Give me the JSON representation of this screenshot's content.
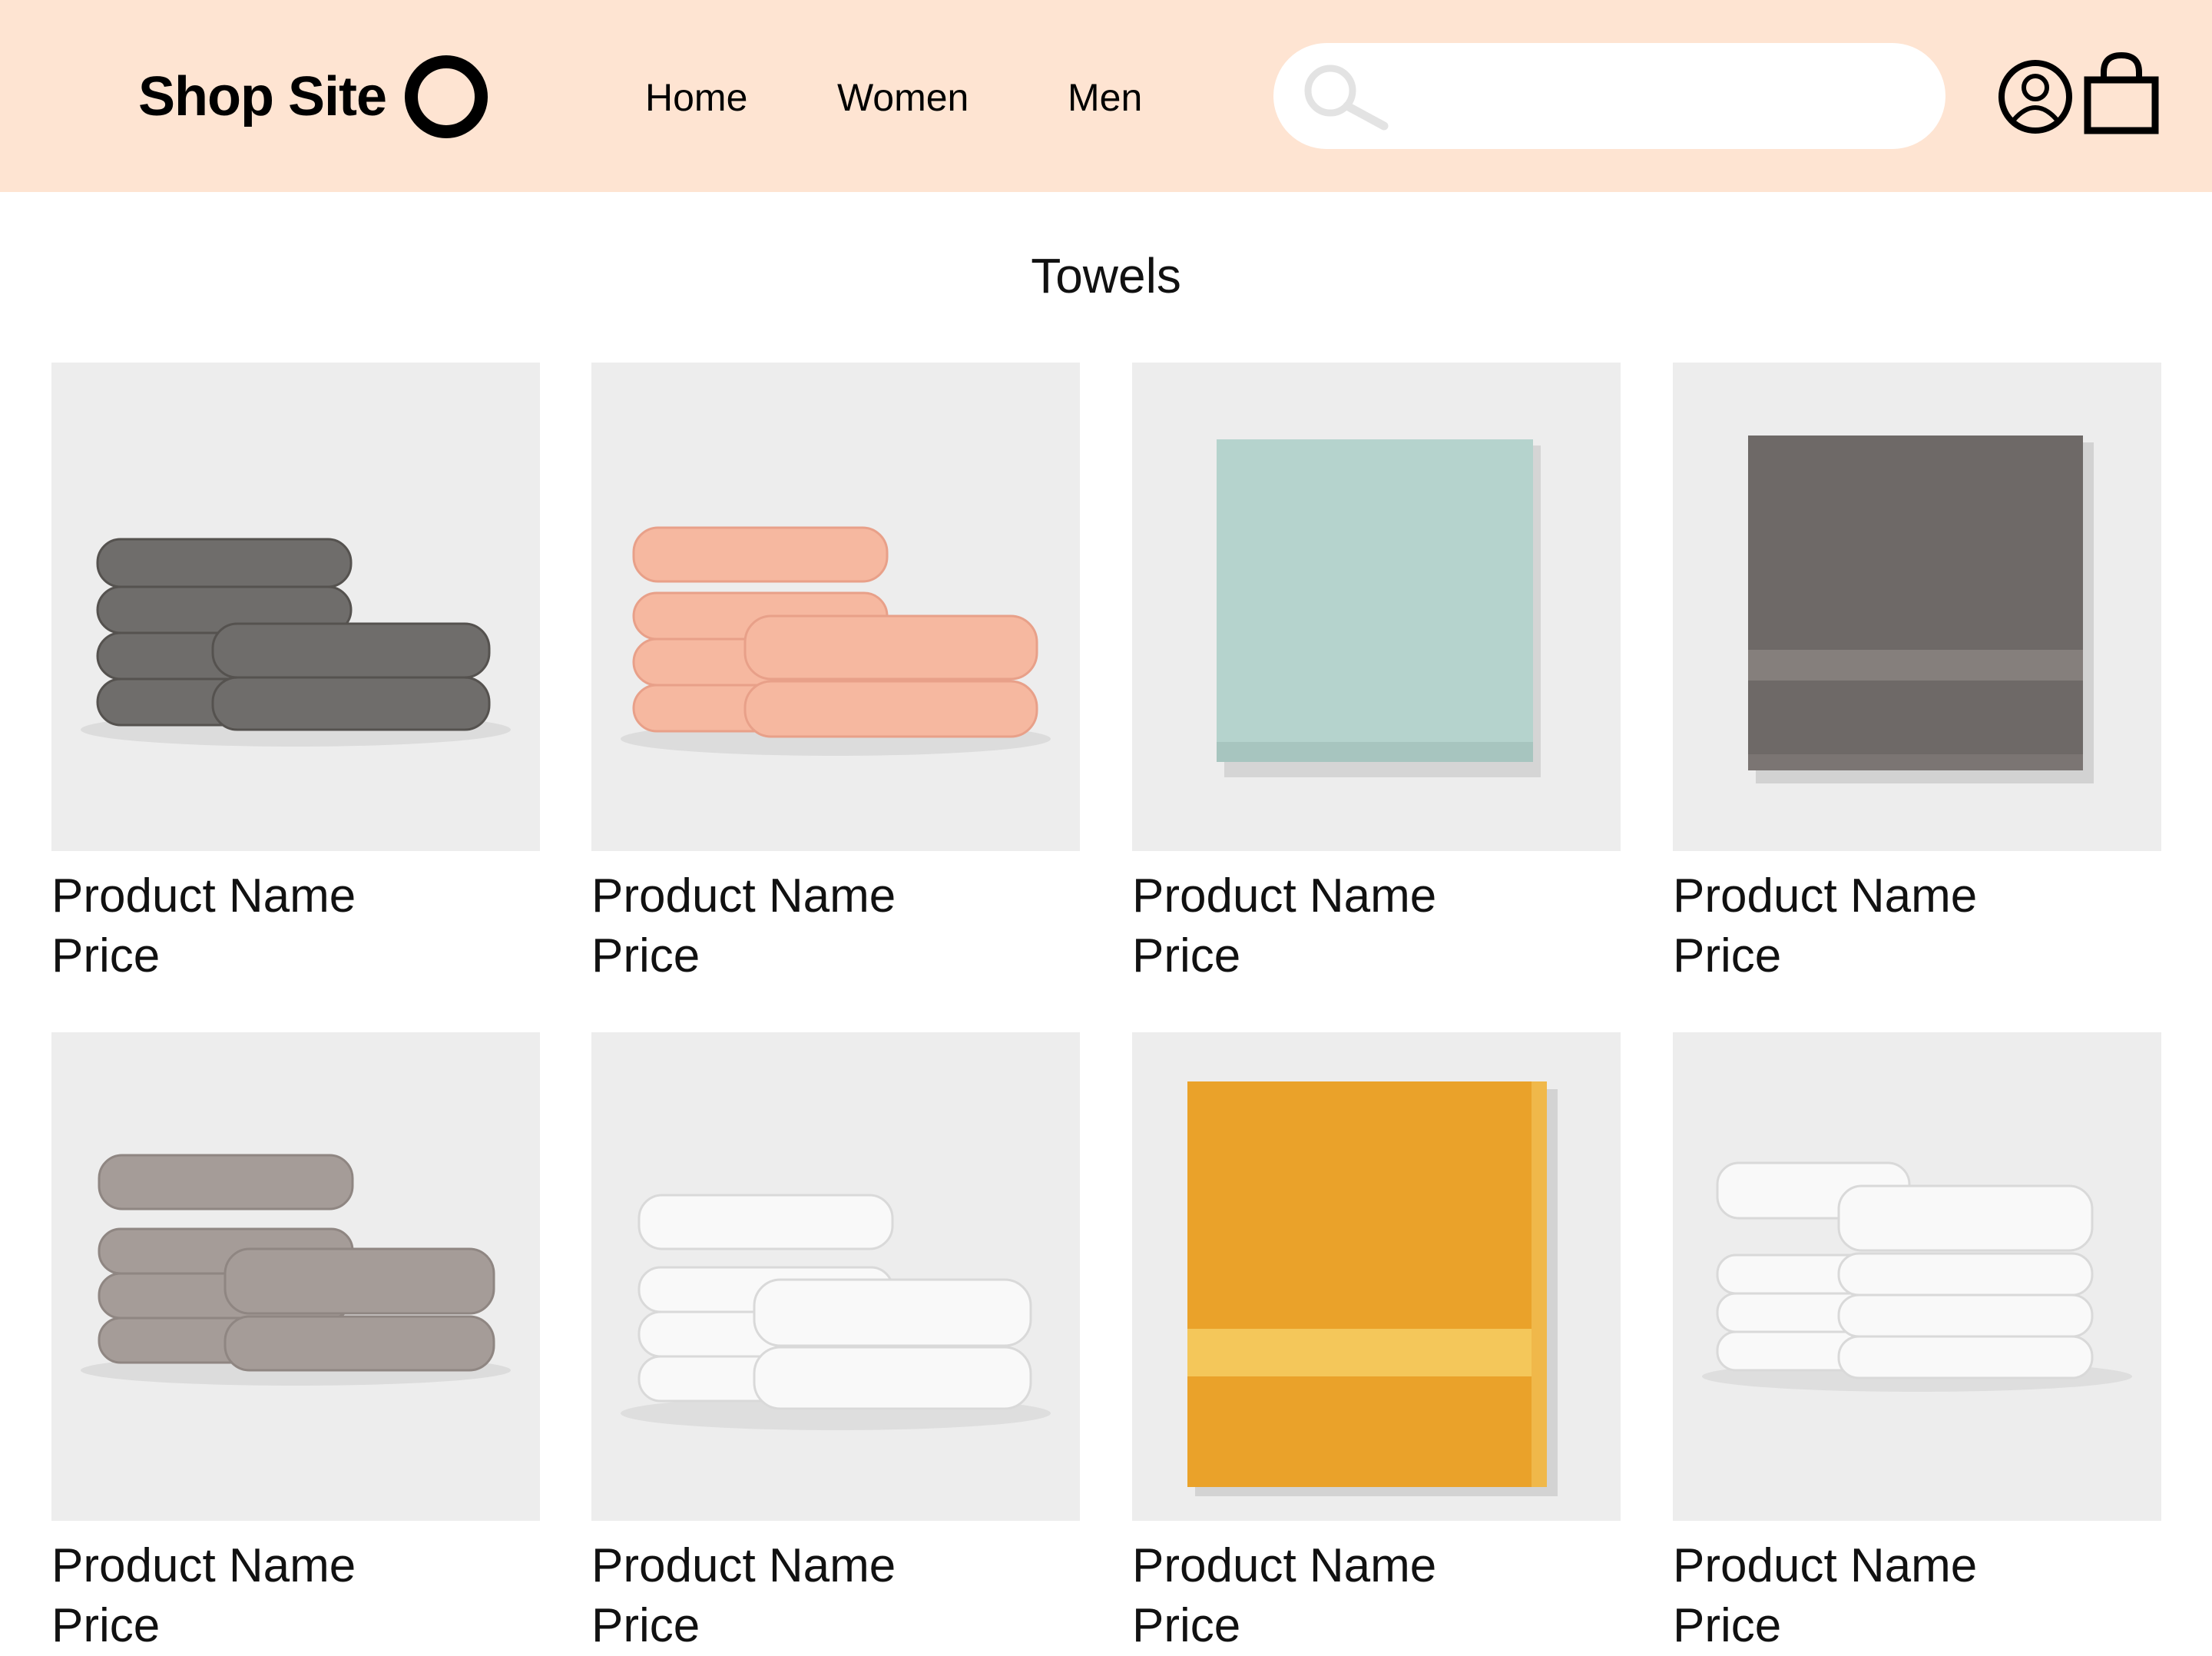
{
  "header": {
    "logo_text": "Shop Site",
    "nav": [
      {
        "label": "Home"
      },
      {
        "label": "Women"
      },
      {
        "label": "Men"
      }
    ],
    "search": {
      "placeholder": "",
      "value": ""
    }
  },
  "page": {
    "title": "Towels"
  },
  "products": [
    {
      "name": "Product Name",
      "price": "Price",
      "image": "stack-gray-towels"
    },
    {
      "name": "Product Name",
      "price": "Price",
      "image": "stack-peach-towels"
    },
    {
      "name": "Product Name",
      "price": "Price",
      "image": "folded-mint-towel"
    },
    {
      "name": "Product Name",
      "price": "Price",
      "image": "folded-charcoal-towel"
    },
    {
      "name": "Product Name",
      "price": "Price",
      "image": "stack-taupe-towels"
    },
    {
      "name": "Product Name",
      "price": "Price",
      "image": "stack-white-towels"
    },
    {
      "name": "Product Name",
      "price": "Price",
      "image": "folded-mustard-towel"
    },
    {
      "name": "Product Name",
      "price": "Price",
      "image": "stack-white-towels-2"
    }
  ],
  "colors": {
    "header_bg": "#fee4d2",
    "image_bg": "#ededed",
    "gray": "#6f6d6b",
    "peach": "#f6b8a0",
    "mint": "#b5d3cd",
    "charcoal": "#6e6967",
    "taupe": "#a59c98",
    "white": "#f7f7f7",
    "mustard": "#eaa22a"
  }
}
